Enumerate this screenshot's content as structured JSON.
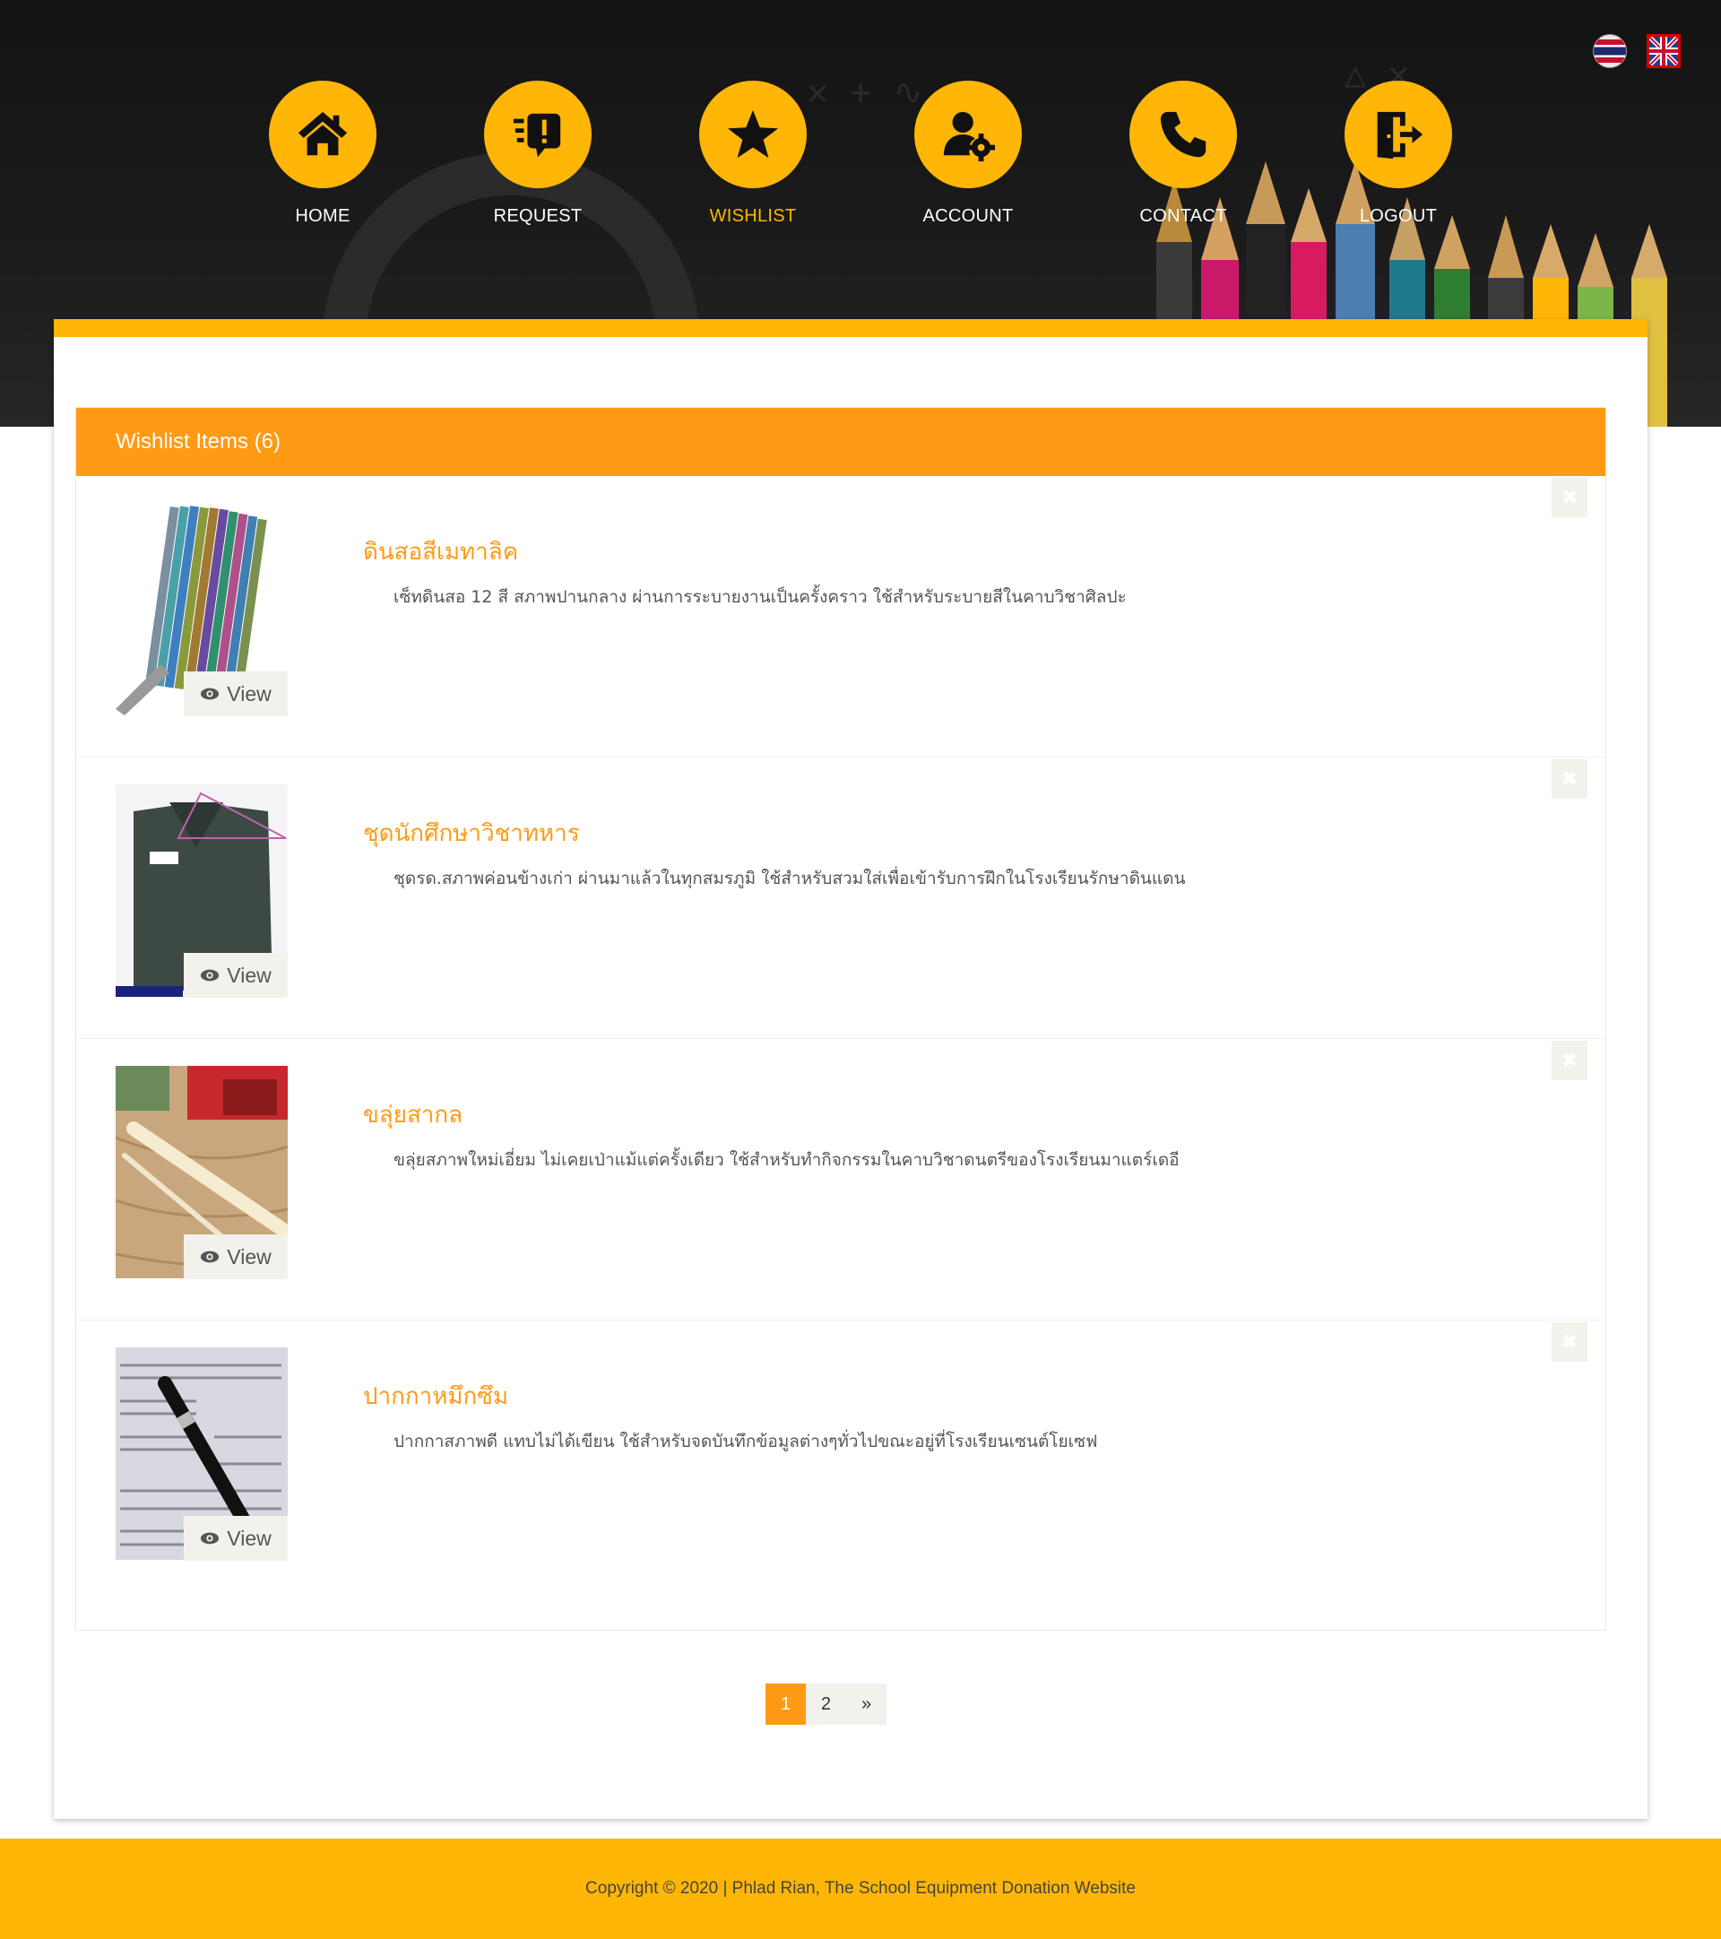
{
  "header": {
    "languages": [
      {
        "name": "thai-flag-icon",
        "label": "TH"
      },
      {
        "name": "uk-flag-icon",
        "label": "EN"
      }
    ],
    "nav": [
      {
        "label": "HOME",
        "icon": "home-icon"
      },
      {
        "label": "REQUEST",
        "icon": "request-icon"
      },
      {
        "label": "WISHLIST",
        "icon": "star-icon",
        "active": true
      },
      {
        "label": "ACCOUNT",
        "icon": "account-settings-icon"
      },
      {
        "label": "CONTACT",
        "icon": "phone-icon"
      },
      {
        "label": "LOGOUT",
        "icon": "logout-icon"
      }
    ]
  },
  "wishlist": {
    "heading": "Wishlist Items (6)",
    "view_label": "View",
    "remove_label": "✖",
    "items": [
      {
        "title": "ดินสอสีเมทาลิค",
        "description": "เซ็ทดินสอ 12 สี สภาพปานกลาง ผ่านการระบายงานเป็นครั้งคราว ใช้สำหรับระบายสีในคาบวิชาศิลปะ",
        "image": "metallic-color-pencils"
      },
      {
        "title": "ชุดนักศึกษาวิชาทหาร",
        "description": "ชุดรด.สภาพค่อนข้างเก่า ผ่านมาแล้วในทุกสมรภูมิ ใช้สำหรับสวมใส่เพื่อเข้ารับการฝึกในโรงเรียนรักษาดินแดน",
        "image": "cadet-uniform"
      },
      {
        "title": "ขลุ่ยสากล",
        "description": "ขลุ่ยสภาพใหม่เอี่ยม ไม่เคยเป่าแม้แต่ครั้งเดียว ใช้สำหรับทำกิจกรรมในคาบวิชาดนตรีของโรงเรียนมาแตร์เดอี",
        "image": "recorder-flute"
      },
      {
        "title": "ปากกาหมึกซึม",
        "description": "ปากกาสภาพดี แทบไม่ได้เขียน ใช้สำหรับจดบันทึกข้อมูลต่างๆทั่วไปขณะอยู่ที่โรงเรียนเซนต์โยเซฟ",
        "image": "fountain-pen"
      }
    ]
  },
  "pagination": {
    "pages": [
      "1",
      "2",
      "»"
    ],
    "current": "1"
  },
  "footer": {
    "copyright": "Copyright © 2020 | Phlad Rian, The School Equipment Donation Website"
  },
  "colors": {
    "accent": "#ffb606",
    "orange": "#ff9a14",
    "dark": "#1b1b1b"
  }
}
